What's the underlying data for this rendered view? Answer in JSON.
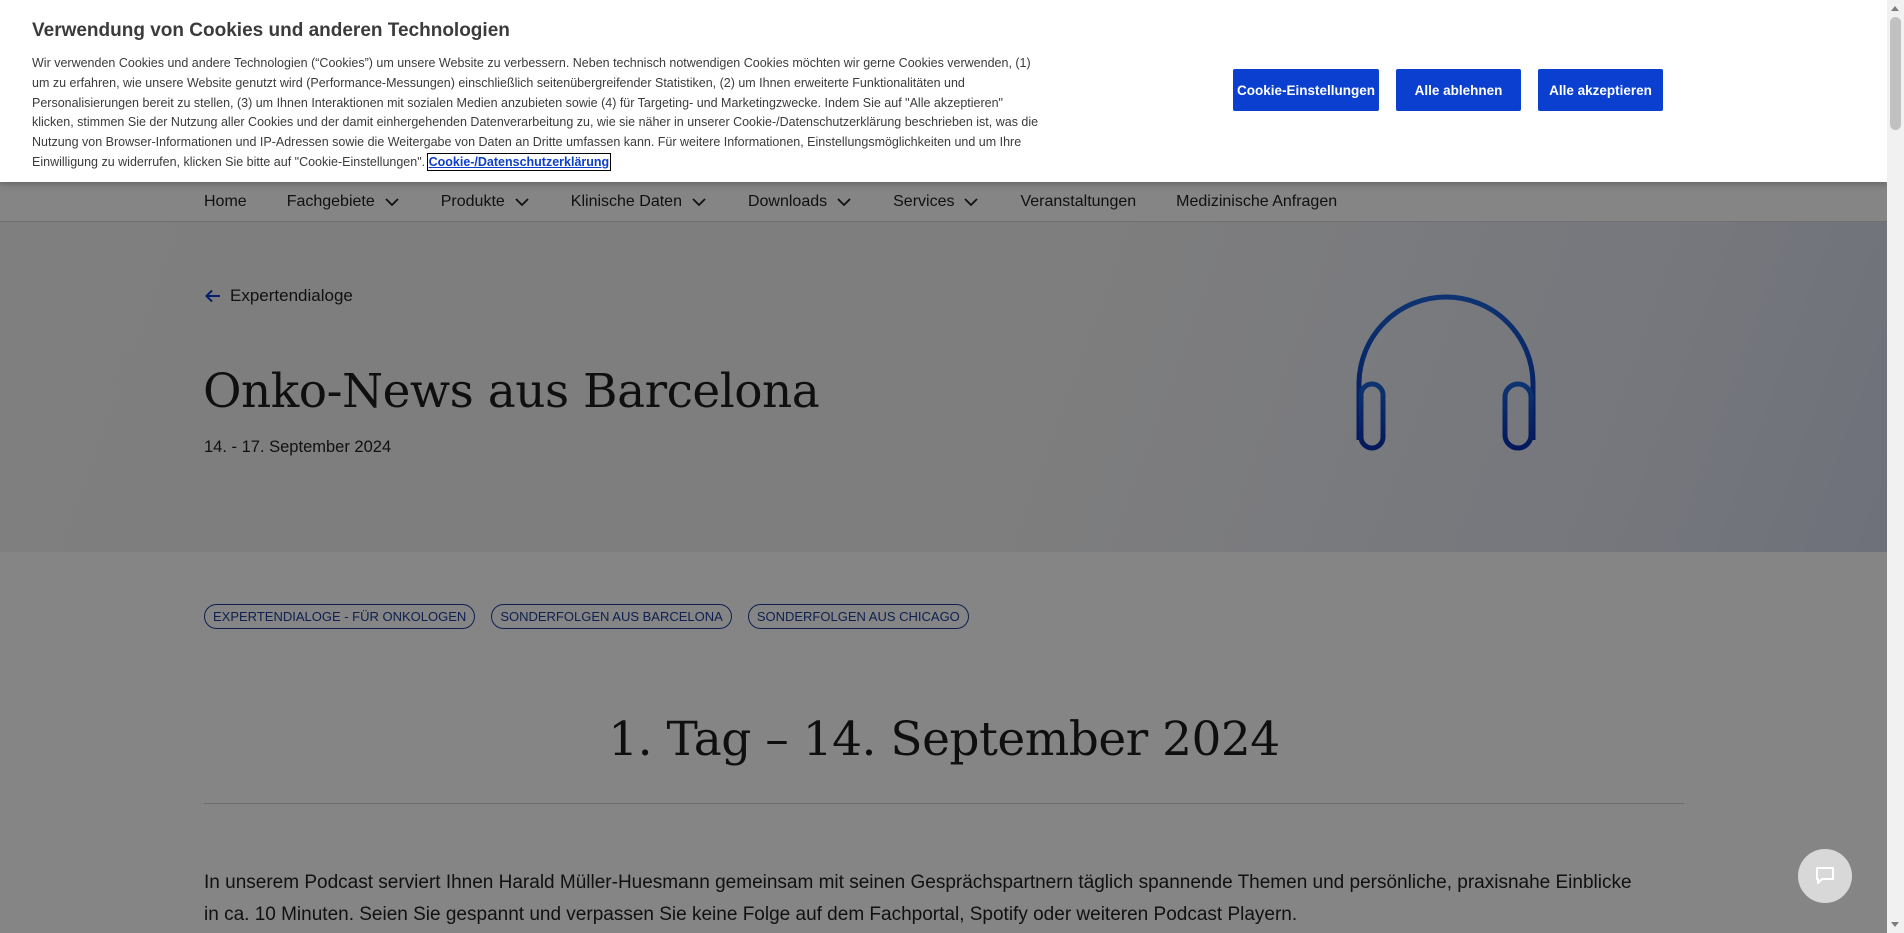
{
  "nav": {
    "items": [
      {
        "label": "Home",
        "has_dropdown": false
      },
      {
        "label": "Fachgebiete",
        "has_dropdown": true
      },
      {
        "label": "Produkte",
        "has_dropdown": true
      },
      {
        "label": "Klinische Daten",
        "has_dropdown": true
      },
      {
        "label": "Downloads",
        "has_dropdown": true
      },
      {
        "label": "Services",
        "has_dropdown": true
      },
      {
        "label": "Veranstaltungen",
        "has_dropdown": false
      },
      {
        "label": "Medizinische Anfragen",
        "has_dropdown": false
      }
    ]
  },
  "hero": {
    "back_label": "Expertendialoge",
    "title": "Onko-News aus Barcelona",
    "date": "14. - 17. September 2024",
    "icon": "headphones-icon",
    "accent_color": "#0a3fcf"
  },
  "tags": [
    "EXPERTENDIALOGE - FÜR ONKOLOGEN",
    "SONDERFOLGEN AUS BARCELONA",
    "SONDERFOLGEN AUS CHICAGO"
  ],
  "section": {
    "title": "1. Tag – 14. September 2024",
    "intro": "In unserem Podcast serviert Ihnen Harald Müller-Huesmann gemeinsam mit seinen Gesprächspartnern täglich spannende Themen und persönliche, praxisnahe Einblicke in ca. 10 Minuten. Seien Sie gespannt und verpassen Sie keine Folge auf dem Fachportal, Spotify oder weiteren Podcast Playern."
  },
  "cookie": {
    "title": "Verwendung von Cookies und anderen Technologien",
    "text": "Wir verwenden Cookies und andere Technologien (“Cookies”) um unsere Website zu verbessern. Neben technisch notwendigen Cookies möchten wir gerne Cookies verwenden, (1) um zu erfahren, wie unsere Website genutzt wird (Performance-Messungen) einschließlich seitenübergreifender Statistiken, (2) um Ihnen erweiterte Funktionalitäten und Personalisierungen bereit zu stellen, (3) um Ihnen Interaktionen mit sozialen Medien anzubieten sowie (4) für Targeting- und Marketingzwecke. Indem Sie auf \"Alle akzeptieren\" klicken, stimmen Sie der Nutzung aller Cookies und der damit einhergehenden Datenverarbeitung zu, wie sie näher in unserer Cookie-/Datenschutzerklärung beschrieben ist, was die Nutzung von Browser-Informationen und IP-Adressen sowie die Weitergabe von Daten an Dritte umfassen kann. Für weitere Informationen, Einstellungsmöglichkeiten und um Ihre Einwilligung zu widerrufen, klicken Sie bitte auf \"Cookie-Einstellungen\". ",
    "link_label": "Cookie-/Datenschutzerklärung",
    "buttons": {
      "settings": "Cookie-Einstellungen",
      "reject": "Alle ablehnen",
      "accept": "Alle akzeptieren"
    },
    "button_color": "#0a3fcf"
  },
  "chat": {
    "icon": "chat-icon"
  }
}
